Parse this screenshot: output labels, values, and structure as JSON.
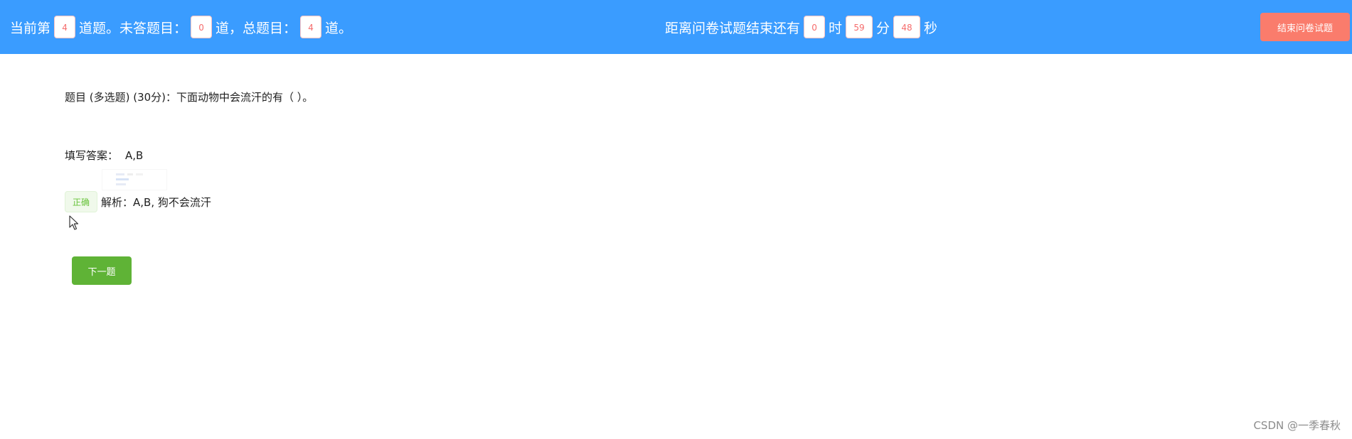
{
  "header": {
    "current_prefix": "当前第",
    "current_number": "4",
    "current_suffix": "道题。未答题目：",
    "unanswered_number": "0",
    "unanswered_suffix": "道，总题目：",
    "total_number": "4",
    "total_suffix": "道。",
    "countdown_prefix": "距离问卷试题结束还有",
    "hours": "0",
    "hours_unit": "时",
    "minutes": "59",
    "minutes_unit": "分",
    "seconds": "48",
    "seconds_unit": "秒",
    "end_button_label": "结束问卷试题"
  },
  "question": {
    "text": "题目 (多选题) (30分)：下面动物中会流汗的有（ ）。"
  },
  "answer": {
    "label": "填写答案：",
    "value": "A,B"
  },
  "result": {
    "status_tag": "正确",
    "analysis": "解析：A,B, 狗不会流汗"
  },
  "actions": {
    "next_label": "下一题"
  },
  "watermark": {
    "text": "CSDN @一季春秋"
  },
  "colors": {
    "header_bg": "#3a9cff",
    "end_button_bg": "#fa7c6c",
    "next_button_bg": "#5fb336",
    "number_text": "#f56c6c",
    "correct_tag_text": "#67c23a"
  }
}
